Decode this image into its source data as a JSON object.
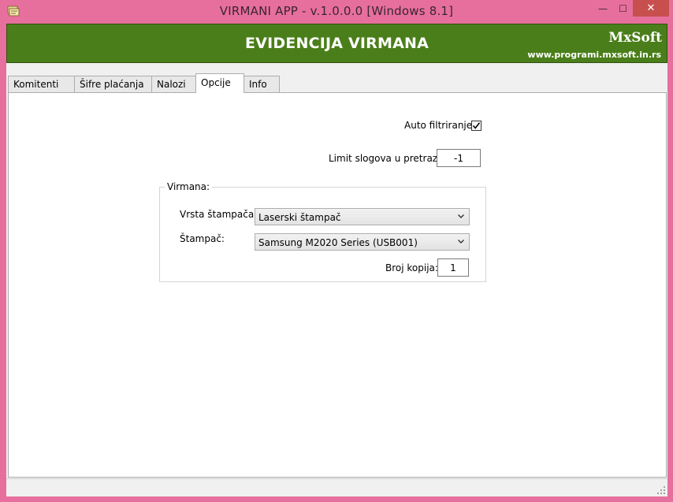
{
  "window": {
    "title": "VIRMANI APP - v.1.0.0.0  [Windows 8.1]",
    "min_glyph": "—",
    "max_glyph": "☐",
    "close_glyph": "✕"
  },
  "header": {
    "title": "EVIDENCIJA VIRMANA",
    "brand": "MxSoft",
    "url": "www.programi.mxsoft.in.rs"
  },
  "tabs": [
    {
      "label": "Komitenti",
      "active": false
    },
    {
      "label": "Šifre plaćanja",
      "active": false
    },
    {
      "label": "Nalozi",
      "active": false
    },
    {
      "label": "Opcije",
      "active": true
    },
    {
      "label": "Info",
      "active": false
    }
  ],
  "options": {
    "auto_filter_label": "Auto filtriranje",
    "auto_filter_checked": true,
    "limit_label": "Limit slogova u pretrazi:",
    "limit_value": "-1"
  },
  "virmana": {
    "caption": "Virmana:",
    "printer_type_label": "Vrsta štampača",
    "printer_type_value": "Laserski štampač",
    "printer_label": "Štampač:",
    "printer_value": "Samsung M2020 Series (USB001)",
    "copies_label": "Broj kopija:",
    "copies_value": "1"
  },
  "colors": {
    "window_frame": "#e76f9d",
    "header_bg": "#4a7e1a",
    "close_button": "#c7504f"
  }
}
